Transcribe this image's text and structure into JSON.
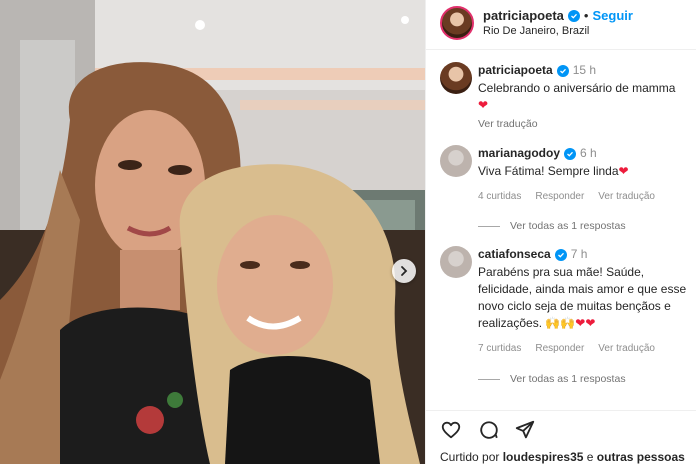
{
  "post": {
    "author": "patriciapoeta",
    "follow_label": "Seguir",
    "separator": "•",
    "location": "Rio De Janeiro, Brazil"
  },
  "caption": {
    "username": "patriciapoeta",
    "time": "15 h",
    "text": "Celebrando o aniversário de mamma",
    "emoji": "❤",
    "translate_label": "Ver tradução"
  },
  "comments": [
    {
      "username": "marianagodoy",
      "time": "6 h",
      "text": "Viva Fátima! Sempre linda",
      "emoji": "❤",
      "likes": "4 curtidas",
      "reply_label": "Responder",
      "translate_label": "Ver tradução",
      "view_replies": "Ver todas as 1 respostas"
    },
    {
      "username": "catiafonseca",
      "time": "7 h",
      "text": "Parabéns pra sua mãe! Saúde, felicidade, ainda mais amor e que esse novo ciclo seja de muitas bençãos e realizações.",
      "emoji": "🙌🙌❤❤",
      "likes": "7 curtidas",
      "reply_label": "Responder",
      "translate_label": "Ver tradução",
      "view_replies": "Ver todas as 1 respostas"
    }
  ],
  "footer": {
    "liked_prefix": "Curtido por",
    "liked_user": "loudespires35",
    "liked_conj": "e",
    "liked_others": "outras pessoas"
  },
  "colors": {
    "accent": "#0095f6",
    "heart": "#ed1c3c",
    "story_ring": "#e1306c"
  },
  "icons": {
    "next": "chevron-right-icon",
    "comment": "comment-icon",
    "share": "share-icon",
    "heart": "heart-icon",
    "verified": "verified-badge-icon"
  }
}
